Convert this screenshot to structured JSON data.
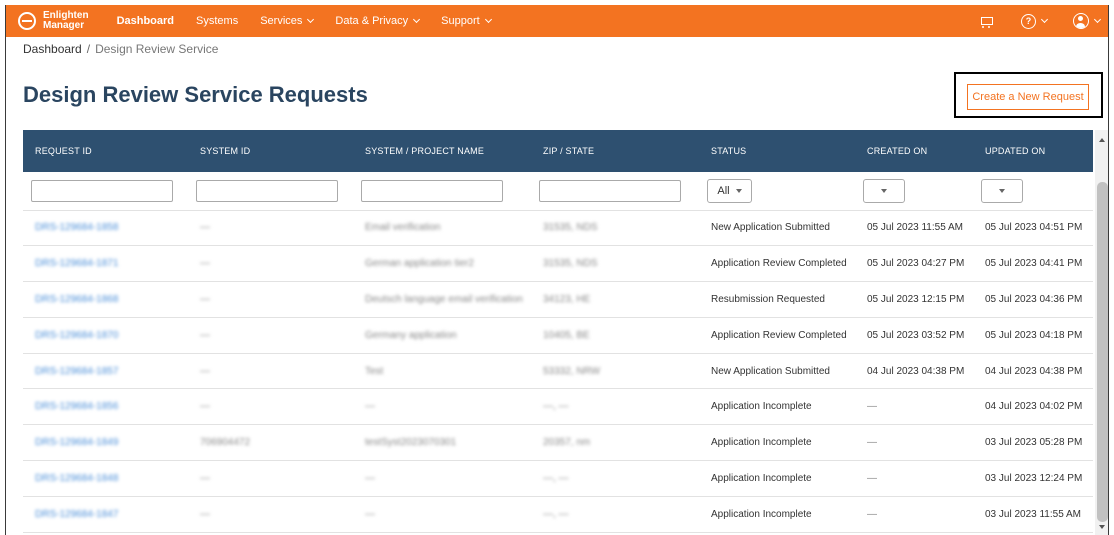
{
  "nav": {
    "logo_line1": "Enlighten",
    "logo_line2": "Manager",
    "items": [
      {
        "label": "Dashboard"
      },
      {
        "label": "Systems"
      },
      {
        "label": "Services"
      },
      {
        "label": "Data & Privacy"
      },
      {
        "label": "Support"
      }
    ]
  },
  "breadcrumb": {
    "home": "Dashboard",
    "separator": "/",
    "current": "Design Review Service"
  },
  "page": {
    "title": "Design Review Service Requests",
    "create_button": "Create a New Request"
  },
  "table": {
    "headers": [
      "REQUEST ID",
      "SYSTEM ID",
      "SYSTEM / PROJECT NAME",
      "ZIP / STATE",
      "STATUS",
      "CREATED ON",
      "UPDATED ON"
    ],
    "status_filter": "All",
    "rows": [
      {
        "request_id": "DRS-129684-1858",
        "system_id": "—",
        "name": "Email verification",
        "zip": "31535, NDS",
        "status": "New Application Submitted",
        "created": "05 Jul 2023 11:55 AM",
        "updated": "05 Jul 2023 04:51 PM"
      },
      {
        "request_id": "DRS-129684-1871",
        "system_id": "—",
        "name": "German application tier2",
        "zip": "31535, NDS",
        "status": "Application Review Completed",
        "created": "05 Jul 2023 04:27 PM",
        "updated": "05 Jul 2023 04:41 PM"
      },
      {
        "request_id": "DRS-129684-1868",
        "system_id": "—",
        "name": "Deutsch language email verification",
        "zip": "34123, HE",
        "status": "Resubmission Requested",
        "created": "05 Jul 2023 12:15 PM",
        "updated": "05 Jul 2023 04:36 PM"
      },
      {
        "request_id": "DRS-129684-1870",
        "system_id": "—",
        "name": "Germany application",
        "zip": "10405, BE",
        "status": "Application Review Completed",
        "created": "05 Jul 2023 03:52 PM",
        "updated": "05 Jul 2023 04:18 PM"
      },
      {
        "request_id": "DRS-129684-1857",
        "system_id": "—",
        "name": "Test",
        "zip": "53332, NRW",
        "status": "New Application Submitted",
        "created": "04 Jul 2023 04:38 PM",
        "updated": "04 Jul 2023 04:38 PM"
      },
      {
        "request_id": "DRS-129684-1856",
        "system_id": "—",
        "name": "—",
        "zip": "—, —",
        "status": "Application Incomplete",
        "created": "—",
        "updated": "04 Jul 2023 04:02 PM"
      },
      {
        "request_id": "DRS-129684-1849",
        "system_id": "706904472",
        "name": "testSyst2023070301",
        "zip": "20357, nm",
        "status": "Application Incomplete",
        "created": "—",
        "updated": "03 Jul 2023 05:28 PM"
      },
      {
        "request_id": "DRS-129684-1848",
        "system_id": "—",
        "name": "—",
        "zip": "—, —",
        "status": "Application Incomplete",
        "created": "—",
        "updated": "03 Jul 2023 12:24 PM"
      },
      {
        "request_id": "DRS-129684-1847",
        "system_id": "—",
        "name": "—",
        "zip": "—, —",
        "status": "Application Incomplete",
        "created": "—",
        "updated": "03 Jul 2023 11:55 AM"
      }
    ]
  },
  "colors": {
    "nav_bg": "#f37321",
    "header_bg": "#2e5070",
    "title": "#2a4560",
    "link": "#4a8ed8",
    "accent": "#f37321"
  }
}
